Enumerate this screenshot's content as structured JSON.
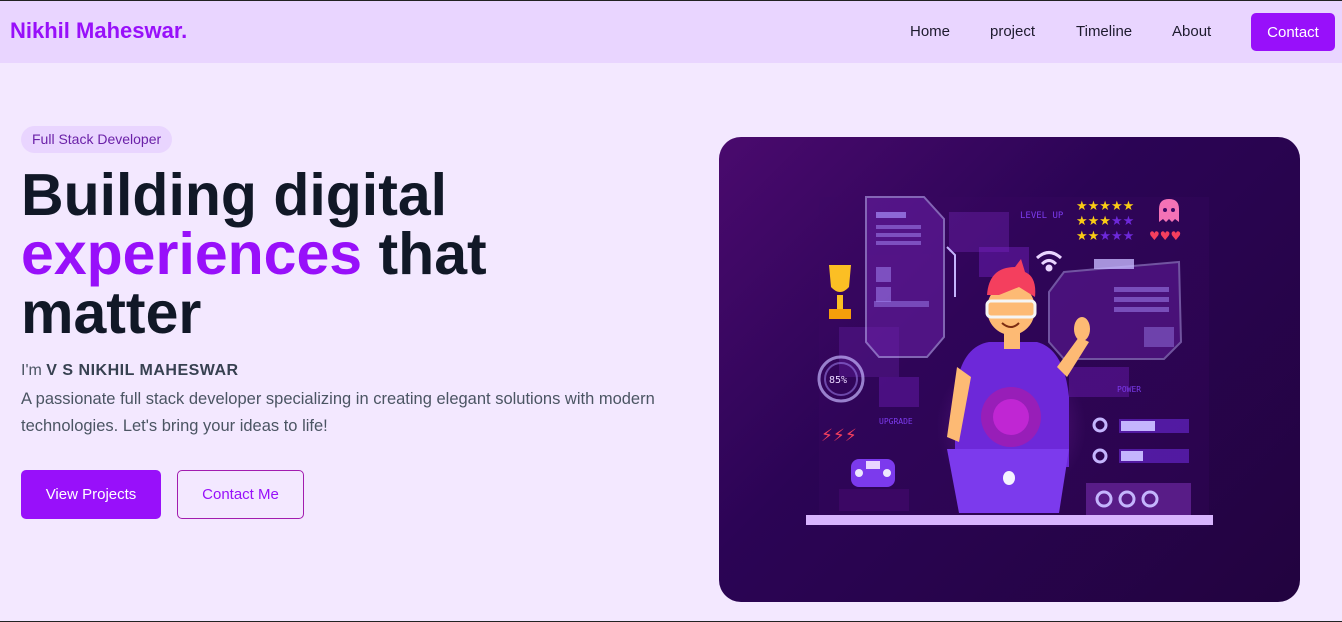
{
  "header": {
    "brand": "Nikhil Maheswar.",
    "nav": [
      {
        "label": "Home"
      },
      {
        "label": "project"
      },
      {
        "label": "Timeline"
      },
      {
        "label": "About"
      }
    ],
    "contact_label": "Contact"
  },
  "hero": {
    "badge": "Full Stack Developer",
    "headline_part1": "Building digital",
    "headline_highlight": "experiences",
    "headline_part2": " that",
    "headline_part3": "matter",
    "intro_prefix": "I'm ",
    "name": "V S NIKHIL MAHESWAR",
    "description": "A passionate full stack developer specializing in creating elegant solutions with modern technologies. Let's bring your ideas to life!",
    "primary_button": "View Projects",
    "secondary_button": "Contact Me"
  },
  "illustration": {
    "level_up": "LEVEL UP",
    "percent": "85%",
    "upgrade": "UPGRADE",
    "power": "POWER"
  },
  "colors": {
    "accent": "#9810fa",
    "background": "#f3e8ff",
    "nav_background": "#e9d5ff",
    "heading": "#111827"
  }
}
